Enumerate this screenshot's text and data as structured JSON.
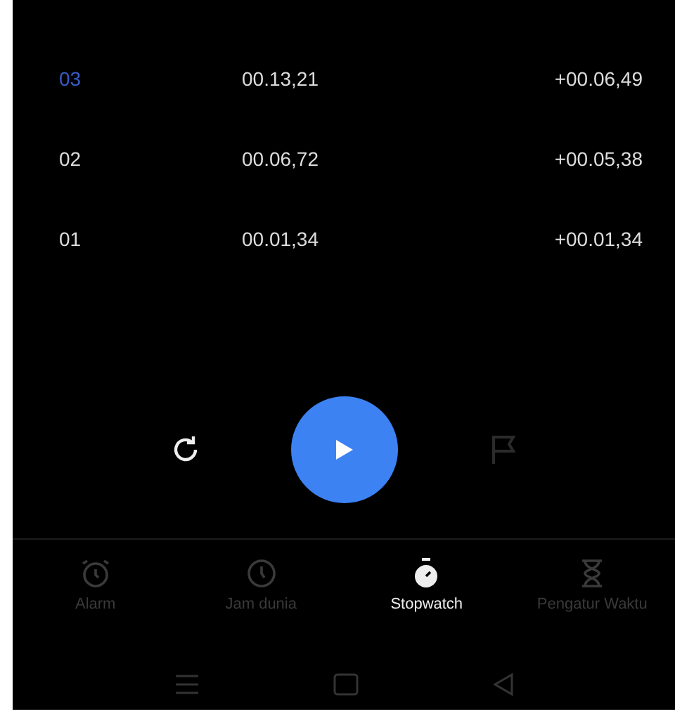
{
  "laps": [
    {
      "number": "03",
      "total": "00.13,21",
      "split": "+00.06,49",
      "selected": true
    },
    {
      "number": "02",
      "total": "00.06,72",
      "split": "+00.05,38",
      "selected": false
    },
    {
      "number": "01",
      "total": "00.01,34",
      "split": "+00.01,34",
      "selected": false
    }
  ],
  "controls": {
    "reset": {
      "disabled": false
    },
    "play": {
      "disabled": false
    },
    "lap": {
      "disabled": true
    }
  },
  "tabs": [
    {
      "kind": "alarm",
      "label": "Alarm",
      "selected": false
    },
    {
      "kind": "clock",
      "label": "Jam dunia",
      "selected": false
    },
    {
      "kind": "stopwatch",
      "label": "Stopwatch",
      "selected": true
    },
    {
      "kind": "timer",
      "label": "Pengatur Waktu",
      "selected": false
    }
  ]
}
